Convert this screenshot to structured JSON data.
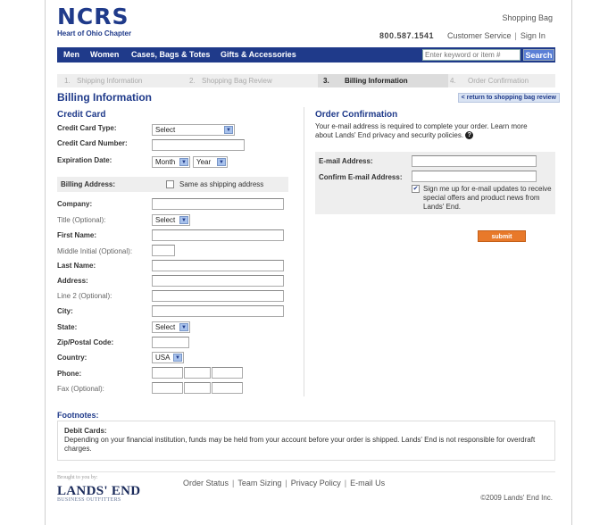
{
  "header": {
    "logo_text": "NCRS",
    "chapter": "Heart of Ohio Chapter",
    "shopping_bag": "Shopping Bag",
    "phone": "800.587.1541",
    "customer_service": "Customer Service",
    "separator": "|",
    "sign_in": "Sign In"
  },
  "nav": {
    "items": [
      "Men",
      "Women",
      "Cases, Bags & Totes",
      "Gifts & Accessories"
    ],
    "search_placeholder": "Enter keyword or item #",
    "search_button": "Search"
  },
  "steps": [
    {
      "num": "1.",
      "label": "Shipping Information"
    },
    {
      "num": "2.",
      "label": "Shopping Bag Review"
    },
    {
      "num": "3.",
      "label": "Billing Information"
    },
    {
      "num": "4.",
      "label": "Order Confirmation"
    }
  ],
  "page": {
    "title": "Billing Information",
    "return_link": "< return to shopping bag review"
  },
  "credit_card": {
    "section_title": "Credit Card",
    "type_label": "Credit Card Type:",
    "type_value": "Select",
    "number_label": "Credit Card Number:",
    "expiration_label": "Expiration Date:",
    "month_value": "Month",
    "year_value": "Year"
  },
  "billing": {
    "label": "Billing Address:",
    "same_as_shipping": "Same as shipping address",
    "company": "Company:",
    "title": "Title (Optional):",
    "title_value": "Select",
    "first_name": "First Name:",
    "middle_initial": "Middle Initial (Optional):",
    "last_name": "Last Name:",
    "address": "Address:",
    "line2": "Line 2 (Optional):",
    "city": "City:",
    "state": "State:",
    "state_value": "Select",
    "zip": "Zip/Postal Code:",
    "country": "Country:",
    "country_value": "USA",
    "phone": "Phone:",
    "fax": "Fax (Optional):"
  },
  "order_confirmation": {
    "title": "Order Confirmation",
    "description": "Your e-mail address is required to complete your order. Learn more about Lands' End privacy and security policies.",
    "email_label": "E-mail Address:",
    "confirm_label": "Confirm E-mail Address:",
    "signup_text": "Sign me up for e-mail updates to receive special offers and product news from Lands' End.",
    "signup_checked": true,
    "submit": "submit"
  },
  "footnotes": {
    "title": "Footnotes:",
    "heading": "Debit Cards:",
    "text": "Depending on your financial institution, funds may be held from your account before your order is shipped. Lands' End is not responsible for overdraft charges."
  },
  "footer": {
    "brought_by": "Brought to you by:",
    "brand": "LANDS' END",
    "brand_sub": "BUSINESS OUTFITTERS",
    "links": [
      "Order Status",
      "Team Sizing",
      "Privacy Policy",
      "E-mail Us"
    ],
    "copyright": "©2009 Lands' End Inc."
  },
  "colors": {
    "brand_blue": "#1f3a8a",
    "submit_orange": "#e8792a"
  }
}
